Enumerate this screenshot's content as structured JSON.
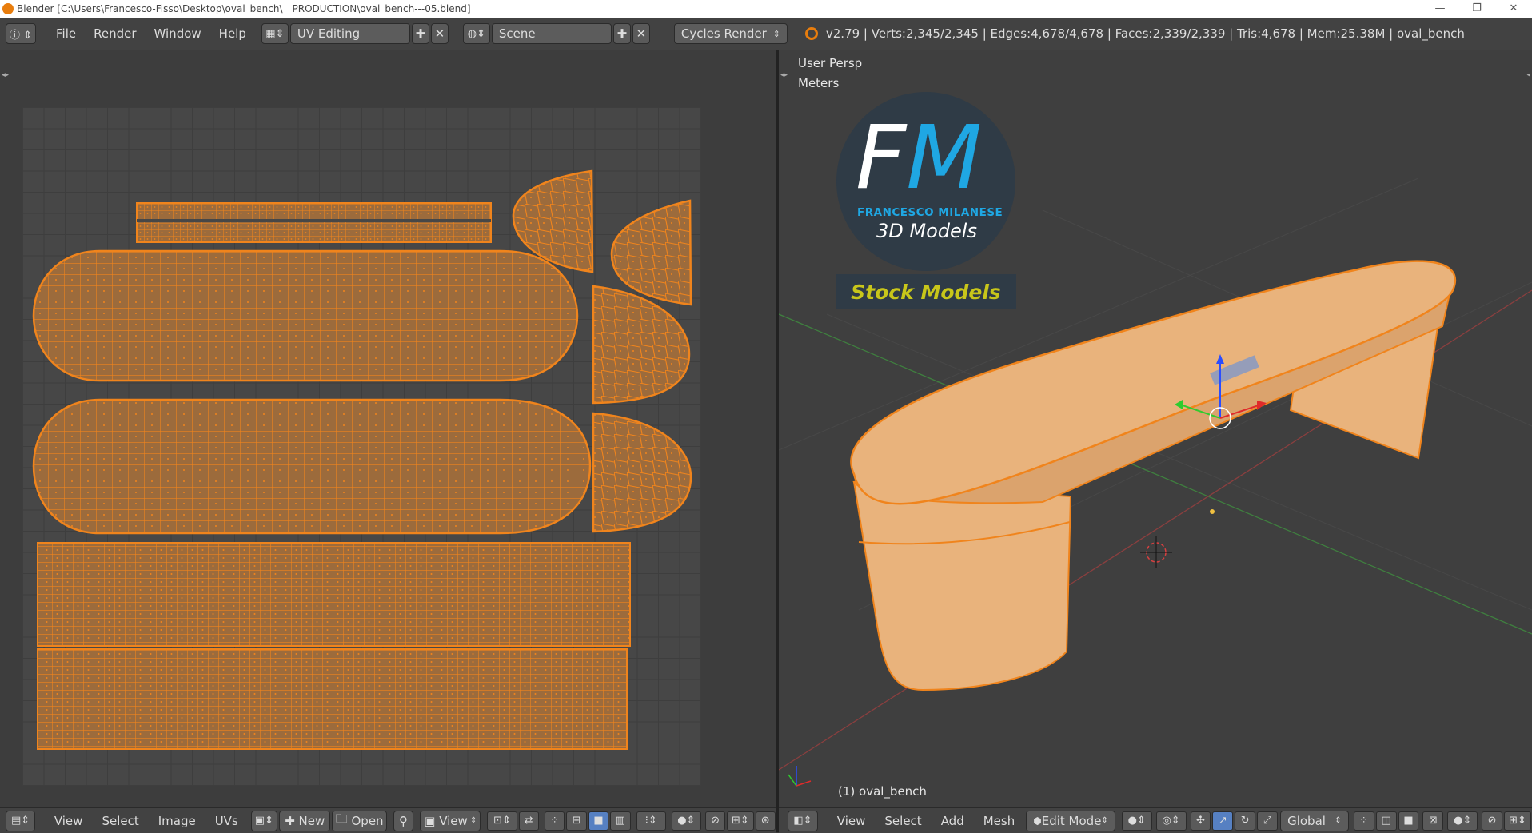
{
  "window": {
    "title": "Blender [C:\\Users\\Francesco-Fisso\\Desktop\\oval_bench\\__PRODUCTION\\oval_bench---05.blend]",
    "minimize": "—",
    "restore": "❐",
    "close": "✕"
  },
  "info_header": {
    "menus": [
      "File",
      "Render",
      "Window",
      "Help"
    ],
    "screen_layout": "UV Editing",
    "scene": "Scene",
    "render_engine": "Cycles Render",
    "stats": "v2.79 | Verts:2,345/2,345 | Edges:4,678/4,678 | Faces:2,339/2,339 | Tris:4,678 | Mem:25.38M | oval_bench"
  },
  "uv_editor": {
    "menus": [
      "View",
      "Select",
      "Image",
      "UVs"
    ],
    "new_label": "New",
    "open_label": "Open",
    "view_label": "View"
  },
  "viewport": {
    "view_name": "User Persp",
    "units": "Meters",
    "object_label": "(1) oval_bench",
    "menus": [
      "View",
      "Select",
      "Add",
      "Mesh"
    ],
    "mode": "Edit Mode",
    "orientation": "Global"
  },
  "logo": {
    "letters_f": "F",
    "letters_m": "M",
    "name": "FRANCESCO MILANESE",
    "tagline": "3D Models",
    "badge": "Stock Models"
  },
  "colors": {
    "uv_wire": "#f0841c",
    "uv_fill": "#9a6a3c",
    "mesh_face": "#e8b07a",
    "logo_blue": "#1fa7e3",
    "badge_text": "#c8c61a",
    "selected_button": "#5680c2"
  }
}
